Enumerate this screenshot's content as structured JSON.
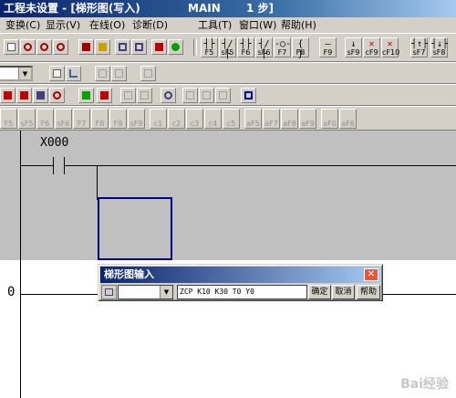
{
  "window": {
    "title": "工程未设置 - [梯形图(写入)",
    "program": "MAIN",
    "steps": "1 步]"
  },
  "menu": [
    {
      "label": "变换(C)"
    },
    {
      "label": "显示(V)"
    },
    {
      "label": "在线(O)"
    },
    {
      "label": "诊断(D)"
    },
    {
      "label": "工具(T)"
    },
    {
      "label": "窗口(W)"
    },
    {
      "label": "帮助(H)"
    }
  ],
  "ladder_toolbar": [
    {
      "symbol": "┤├",
      "key": "F5"
    },
    {
      "symbol": "┤/├",
      "key": "sF5"
    },
    {
      "symbol": "┤├",
      "key": "F6"
    },
    {
      "symbol": "┤/├",
      "key": "sF6"
    },
    {
      "symbol": "-○-",
      "key": "F7"
    },
    {
      "symbol": "{ }",
      "key": "F8"
    },
    {
      "symbol": "—",
      "key": "F9"
    },
    {
      "symbol": "↓",
      "key": "sF9"
    },
    {
      "symbol": "✕",
      "key": "cF9"
    },
    {
      "symbol": "✕",
      "key": "cF10"
    },
    {
      "symbol": "┤↑├",
      "key": "sF7"
    },
    {
      "symbol": "┤↓├",
      "key": "sF8"
    }
  ],
  "func_keys": [
    "F5",
    "sF5",
    "F6",
    "sF6",
    "F7",
    "F8",
    "F9",
    "sF9",
    "c1",
    "c2",
    "c3",
    "c4",
    "c5",
    "aF5",
    "aF7",
    "aF8",
    "aF9",
    "aF0",
    "aF6"
  ],
  "ladder": {
    "device": "X000",
    "step_number": "0"
  },
  "dialog": {
    "title": "梯形图输入",
    "instruction": "ZCP K10 K30 T0 Y0",
    "ok_label": "确定",
    "cancel_label": "取消",
    "help_label": "帮助"
  },
  "watermark": "Bai经验",
  "colors": {
    "title_start": "#0a246a",
    "title_end": "#a6caf0",
    "face": "#d4d0c8",
    "canvas_gray": "#c0c0c0",
    "cursor": "#00008b",
    "close": "#e45a3c"
  }
}
